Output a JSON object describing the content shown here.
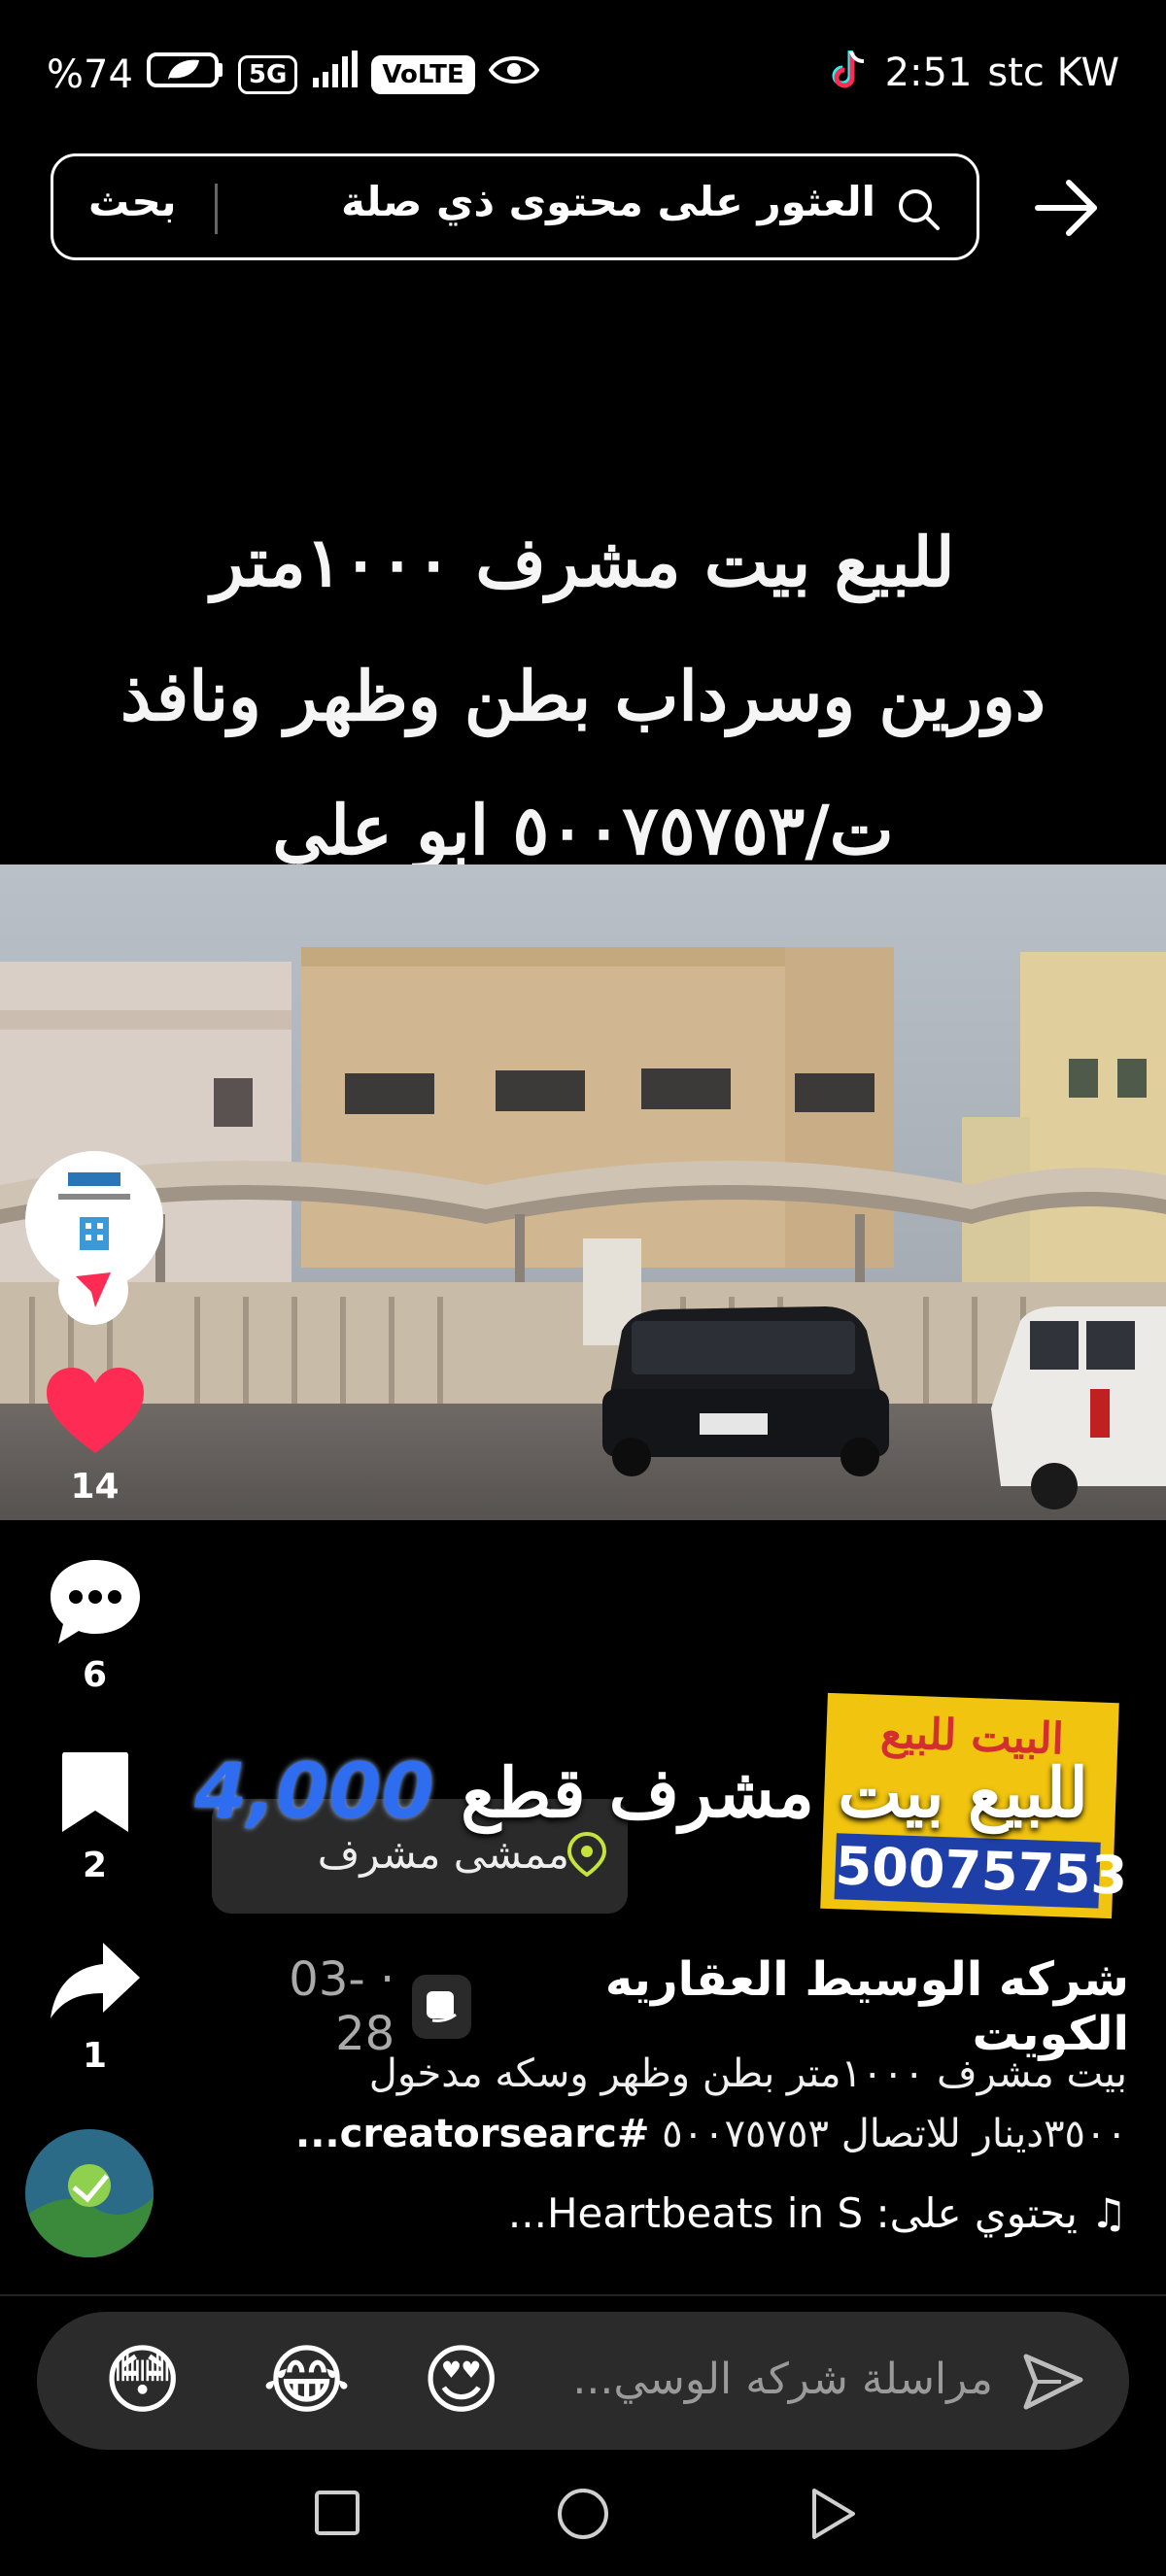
{
  "status_bar": {
    "battery": "%74",
    "network": "5G",
    "volte": "VoLTE",
    "time": "2:51",
    "carrier": "stc KW"
  },
  "search": {
    "query": "العثور على محتوى ذي صلة",
    "button": "بحث"
  },
  "overlay": {
    "line1": "للبيع بيت مشرف ١٠٠٠متر",
    "line2": "دورين وسرداب بطن وظهر ونافذ",
    "line3": "ت/٥٠٠٧٥٧٥٣  ابو علي"
  },
  "ad": {
    "sticker_top": "البيت للبيع",
    "sticker_phone": "50075753",
    "headline": "للبيع بيت مشرف قطع",
    "price": "4,000",
    "location": "ممشى مشرف"
  },
  "actions": {
    "likes": "14",
    "comments": "6",
    "saves": "2",
    "shares": "1"
  },
  "post": {
    "author": "شركه الوسيط العقاريه الكويت",
    "date": "03-28",
    "desc_line1": "بيت مشرف ١٠٠٠متر بطن وظهر وسكه مدخول",
    "desc_line2": "٣٥٠٠دينار للاتصال ٥٠٠٧٥٧٥٣",
    "hashtag": "#creatorsearc...",
    "music": "يحتوي على: Heartbeats in S..."
  },
  "comment_bar": {
    "placeholder": "مراسلة شركه الوسي...",
    "emojis": [
      "😍",
      "😂",
      "😳"
    ]
  },
  "colors": {
    "background": "#000000",
    "like": "#fe2c55",
    "comment_bg": "#2b2b2b"
  }
}
